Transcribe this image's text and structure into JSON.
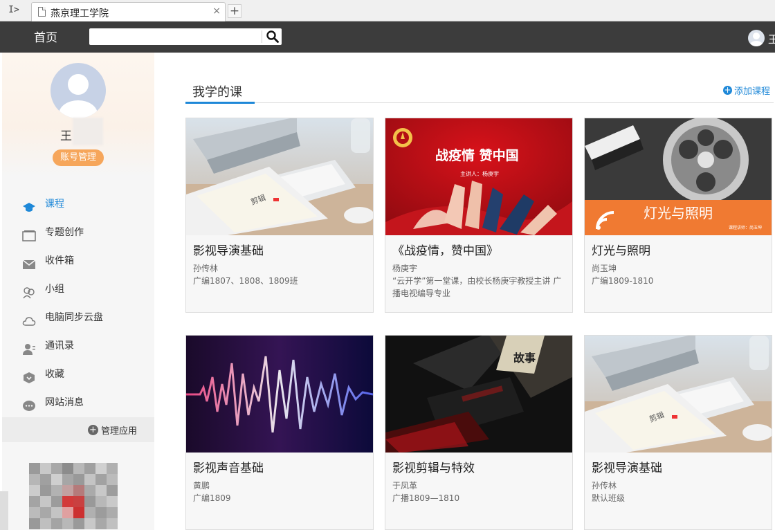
{
  "browser": {
    "tab_title": "燕京理工学院",
    "sidebar_toggle": "I>",
    "close_glyph": "×",
    "new_tab_glyph": "+"
  },
  "topnav": {
    "home_label": "首页",
    "search_placeholder": "",
    "user_initial": "王"
  },
  "profile": {
    "name": "王",
    "account_button": "账号管理"
  },
  "menu": {
    "items": [
      {
        "label": "课程",
        "icon": "graduation-cap-icon",
        "active": true
      },
      {
        "label": "专题创作",
        "icon": "window-icon"
      },
      {
        "label": "收件箱",
        "icon": "mail-icon"
      },
      {
        "label": "小组",
        "icon": "group-icon"
      },
      {
        "label": "电脑同步云盘",
        "icon": "cloud-icon"
      },
      {
        "label": "通讯录",
        "icon": "contacts-icon"
      },
      {
        "label": "收藏",
        "icon": "bookmark-icon"
      },
      {
        "label": "网站消息",
        "icon": "message-icon"
      }
    ],
    "manage_apps": "管理应用",
    "active_color": "#1e88d8"
  },
  "main": {
    "section_title": "我学的课",
    "add_course": "添加课程",
    "courses": [
      {
        "title": "影视导演基础",
        "teacher": "孙传林",
        "desc": "广编1807、1808、1809班",
        "image": "desk-tablet"
      },
      {
        "title": "《战疫情，赞中国》",
        "teacher": "杨庚宇",
        "desc": "“云开学”第一堂课，由校长杨庚宇教授主讲 广播电视编导专业",
        "image": "red-poster",
        "poster_title": "战疫情  赞中国",
        "poster_sub": "主讲人：杨庚宇"
      },
      {
        "title": "灯光与照明",
        "teacher": "尚玉坤",
        "desc": "广编1809-1810",
        "image": "film-reel",
        "banner_title": "灯光与照明",
        "banner_sub": "课程讲师：尚玉坤"
      },
      {
        "title": "影视声音基础",
        "teacher": "黄鹏",
        "desc": "广编1809",
        "image": "sound-wave"
      },
      {
        "title": "影视剪辑与特效",
        "teacher": "于凤革",
        "desc": "广播1809—1810",
        "image": "books-dark",
        "book_text": "故事"
      },
      {
        "title": "影视导演基础",
        "teacher": "孙传林",
        "desc": "默认班级",
        "image": "desk-tablet"
      }
    ]
  }
}
